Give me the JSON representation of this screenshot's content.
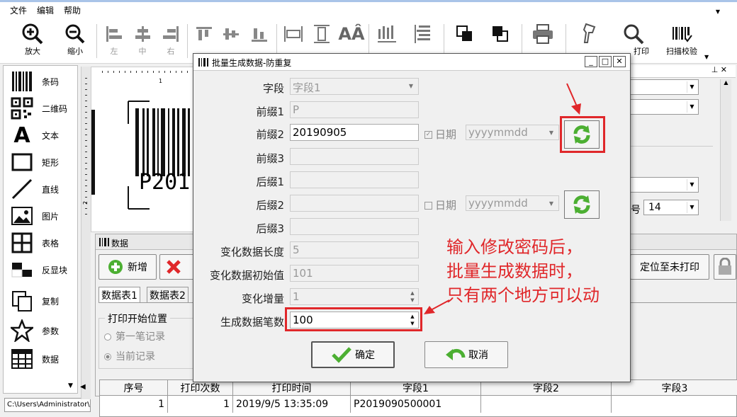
{
  "menu": {
    "items": [
      "文件",
      "编辑",
      "帮助"
    ]
  },
  "toolbar": {
    "zoom_in": "放大",
    "zoom_out": "缩小",
    "align_left": "左",
    "align_center": "中",
    "align_right": "右",
    "print": "打印",
    "scan_verify": "扫描校验"
  },
  "tools": {
    "items": [
      "条码",
      "二维码",
      "文本",
      "矩形",
      "直线",
      "图片",
      "表格",
      "反显块",
      "复制",
      "参数",
      "数据"
    ]
  },
  "status_path": "C:\\Users\\Administrator\\D",
  "canvas": {
    "barcode_text": "P201",
    "ruler_h": "1",
    "ruler_v": "2"
  },
  "right_panel": {
    "font_size_label": "号",
    "font_size_value": "14"
  },
  "data_panel": {
    "title": "数据",
    "add_button": "新增",
    "locate_button": "定位至未打印",
    "tabs": [
      "数据表1",
      "数据表2"
    ],
    "print_start_group": "打印开始位置",
    "radio_first": "第一笔记录",
    "radio_current": "当前记录"
  },
  "grid": {
    "headers": [
      "序号",
      "打印次数",
      "打印时间",
      "字段1",
      "字段2",
      "字段3"
    ],
    "rows": [
      [
        "1",
        "1",
        "2019/9/5 13:35:09",
        "P2019090500001",
        "",
        ""
      ]
    ]
  },
  "dialog": {
    "title": "批量生成数据-防重复",
    "labels": {
      "field": "字段",
      "prefix1": "前缀1",
      "prefix2": "前缀2",
      "prefix3": "前缀3",
      "suffix1": "后缀1",
      "suffix2": "后缀2",
      "suffix3": "后缀3",
      "var_len": "变化数据长度",
      "var_init": "变化数据初始值",
      "var_inc": "变化增量",
      "count": "生成数据笔数"
    },
    "values": {
      "field": "字段1",
      "prefix1": "P",
      "prefix2": "20190905",
      "var_len": "5",
      "var_init": "101",
      "var_inc": "1",
      "count": "100"
    },
    "date_label": "日期",
    "date_format": "yyyymmdd",
    "ok_button": "确定",
    "cancel_button": "取消"
  },
  "annotation": [
    "输入修改密码后，",
    "批量生成数据时，",
    "只有两个地方可以动"
  ],
  "colors": {
    "highlight": "#e0272a",
    "refresh_green": "#4caf32"
  }
}
